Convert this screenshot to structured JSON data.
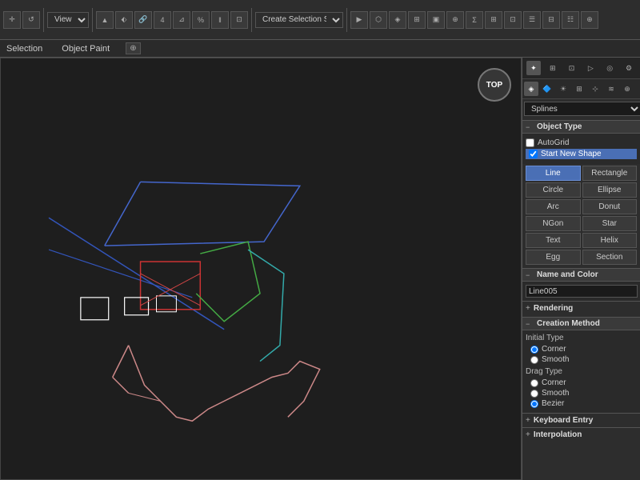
{
  "toolbar": {
    "view_label": "View",
    "create_selection_label": "Create Selection S..."
  },
  "menubar": {
    "selection_label": "Selection",
    "object_paint_label": "Object Paint",
    "badge_label": "⊕"
  },
  "viewport": {
    "compass_label": "TOP"
  },
  "right_panel": {
    "splines_label": "Splines",
    "object_type_title": "Object Type",
    "autogrid_label": "AutoGrid",
    "start_new_shape_label": "Start New Shape",
    "shapes": [
      {
        "id": "line",
        "label": "Line",
        "active": true
      },
      {
        "id": "rectangle",
        "label": "Rectangle",
        "active": false
      },
      {
        "id": "circle",
        "label": "Circle",
        "active": false
      },
      {
        "id": "ellipse",
        "label": "Ellipse",
        "active": false
      },
      {
        "id": "arc",
        "label": "Arc",
        "active": false
      },
      {
        "id": "donut",
        "label": "Donut",
        "active": false
      },
      {
        "id": "ngon",
        "label": "NGon",
        "active": false
      },
      {
        "id": "star",
        "label": "Star",
        "active": false
      },
      {
        "id": "text",
        "label": "Text",
        "active": false
      },
      {
        "id": "helix",
        "label": "Helix",
        "active": false
      },
      {
        "id": "egg",
        "label": "Egg",
        "active": false
      },
      {
        "id": "section",
        "label": "Section",
        "active": false
      }
    ],
    "name_and_color_title": "Name and Color",
    "name_value": "Line005",
    "color_hex": "#6633cc",
    "rendering_label": "Rendering",
    "creation_method_title": "Creation Method",
    "initial_type_label": "Initial Type",
    "corner_label": "Corner",
    "smooth_label": "Smooth",
    "drag_type_label": "Drag Type",
    "drag_corner_label": "Corner",
    "drag_smooth_label": "Smooth",
    "drag_bezier_label": "Bezier",
    "keyboard_entry_label": "Keyboard Entry",
    "interpolation_label": "Interpolation"
  }
}
